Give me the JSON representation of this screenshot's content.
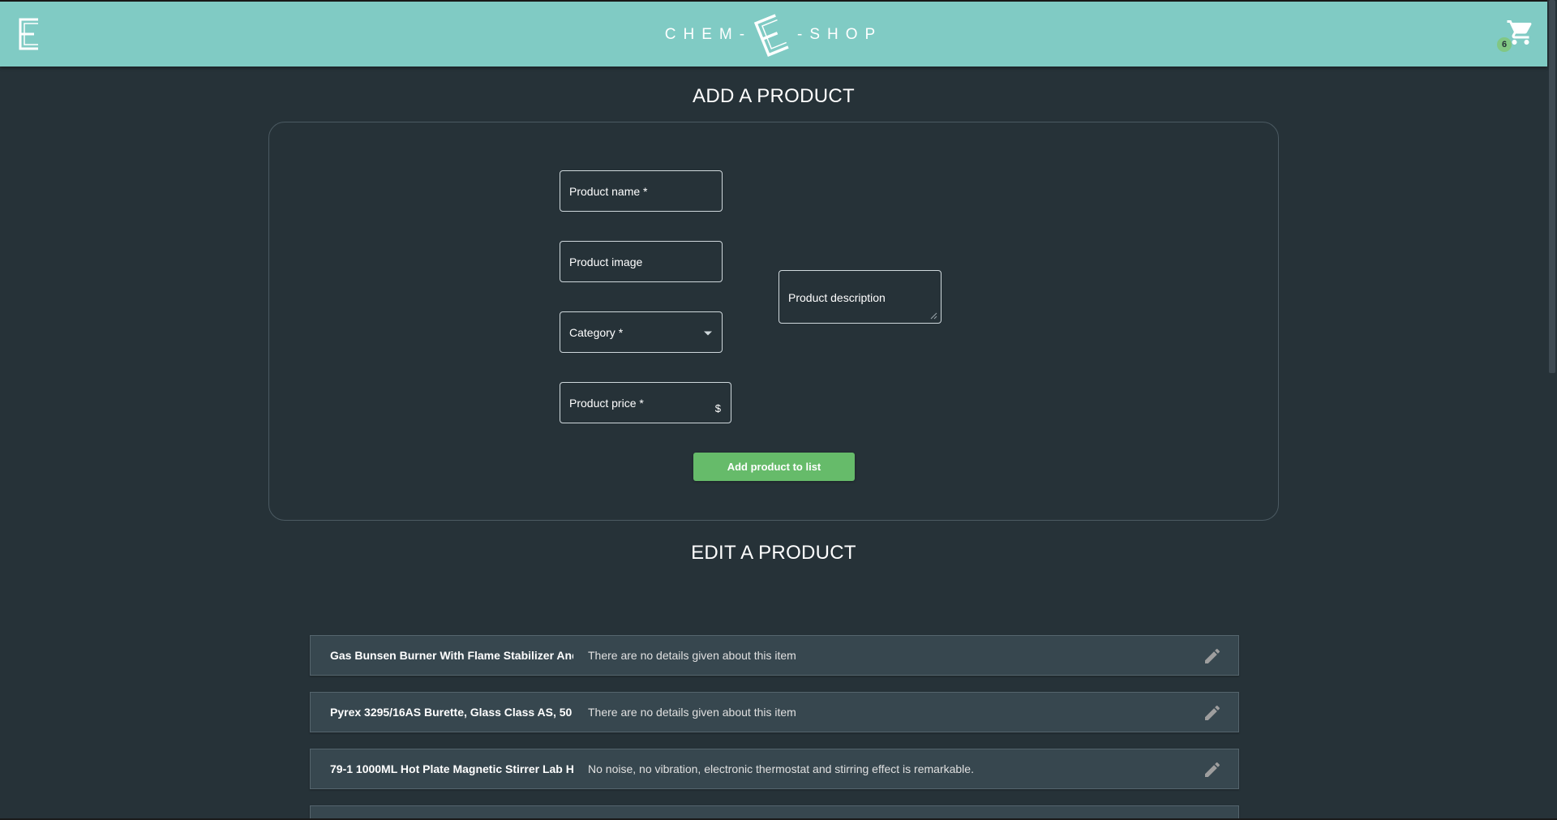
{
  "header": {
    "brand_left": "CHEM-",
    "brand_right": "-SHOP",
    "cart_count": "6",
    "colors": {
      "header_bg": "#80cbc4",
      "badge": "#81c784"
    }
  },
  "add_section": {
    "title": "ADD A PRODUCT",
    "fields": {
      "name_label": "Product name *",
      "image_label": "Product image",
      "category_label": "Category *",
      "price_label": "Product price *",
      "price_adornment": "$",
      "description_label": "Product description"
    },
    "submit_label": "Add product to list",
    "colors": {
      "button": "#66bb6a"
    }
  },
  "edit_section": {
    "title": "EDIT A PRODUCT",
    "products": [
      {
        "name": "Gas Bunsen Burner With Flame Stabilizer And",
        "description": "There are no details given about this item"
      },
      {
        "name": "Pyrex 3295/16AS Burette, Glass Class AS, 50",
        "description": "There are no details given about this item"
      },
      {
        "name": "79-1 1000ML Hot Plate Magnetic Stirrer Lab H",
        "description": "No noise, no vibration, electronic thermostat and stirring effect is remarkable."
      }
    ]
  },
  "theme": {
    "page_bg": "#263238",
    "row_bg": "#37474f"
  }
}
